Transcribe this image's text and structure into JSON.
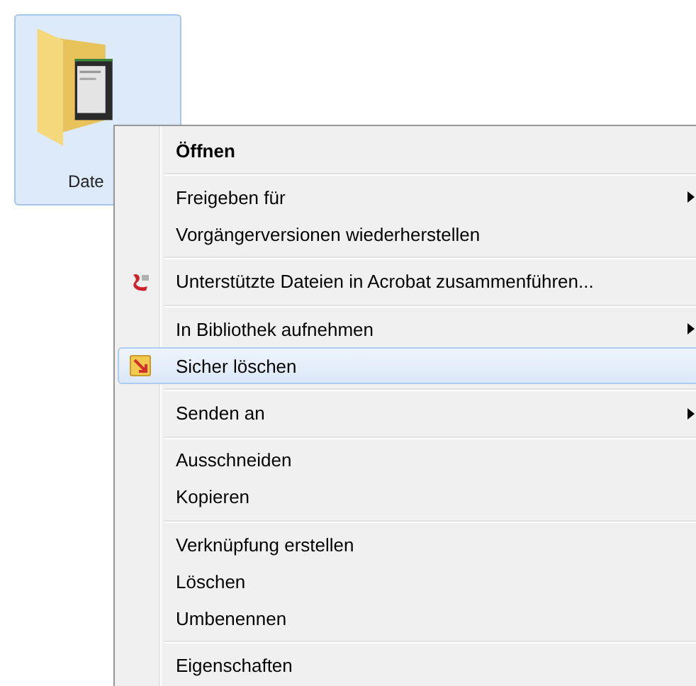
{
  "desktop_item": {
    "label": "Date",
    "selected": true
  },
  "context_menu": {
    "groups": [
      {
        "items": [
          {
            "kind": "plain",
            "label": "Öffnen",
            "bold": true,
            "submenu": false,
            "selected": false
          }
        ]
      },
      {
        "items": [
          {
            "kind": "plain",
            "label": "Freigeben für",
            "bold": false,
            "submenu": true,
            "selected": false
          },
          {
            "kind": "plain",
            "label": "Vorgängerversionen wiederherstellen",
            "bold": false,
            "submenu": false,
            "selected": false
          }
        ]
      },
      {
        "items": [
          {
            "kind": "acrobat",
            "label": "Unterstützte Dateien in Acrobat zusammenführen...",
            "bold": false,
            "submenu": false,
            "selected": false
          }
        ]
      },
      {
        "items": [
          {
            "kind": "plain",
            "label": "In Bibliothek aufnehmen",
            "bold": false,
            "submenu": true,
            "selected": false
          },
          {
            "kind": "shredder",
            "label": "Sicher löschen",
            "bold": false,
            "submenu": false,
            "selected": true
          }
        ]
      },
      {
        "items": [
          {
            "kind": "plain",
            "label": "Senden an",
            "bold": false,
            "submenu": true,
            "selected": false
          }
        ]
      },
      {
        "items": [
          {
            "kind": "plain",
            "label": "Ausschneiden",
            "bold": false,
            "submenu": false,
            "selected": false
          },
          {
            "kind": "plain",
            "label": "Kopieren",
            "bold": false,
            "submenu": false,
            "selected": false
          }
        ]
      },
      {
        "items": [
          {
            "kind": "plain",
            "label": "Verknüpfung erstellen",
            "bold": false,
            "submenu": false,
            "selected": false
          },
          {
            "kind": "plain",
            "label": "Löschen",
            "bold": false,
            "submenu": false,
            "selected": false
          },
          {
            "kind": "plain",
            "label": "Umbenennen",
            "bold": false,
            "submenu": false,
            "selected": false
          }
        ]
      },
      {
        "items": [
          {
            "kind": "plain",
            "label": "Eigenschaften",
            "bold": false,
            "submenu": false,
            "selected": false
          }
        ]
      }
    ]
  }
}
